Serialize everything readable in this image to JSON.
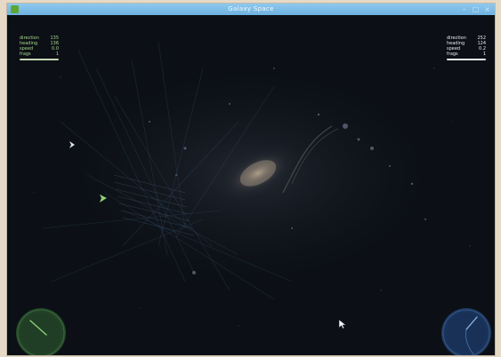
{
  "window": {
    "title": "Galaxy Space",
    "controls": [
      "–",
      "□",
      "×"
    ]
  },
  "hud_left": {
    "rows": [
      {
        "label": "direction",
        "value": "135"
      },
      {
        "label": "heading",
        "value": "136"
      },
      {
        "label": "speed",
        "value": "0.0"
      },
      {
        "label": "frags",
        "value": "1"
      }
    ],
    "bar_fill": 1.0
  },
  "hud_right": {
    "rows": [
      {
        "label": "direction",
        "value": "252"
      },
      {
        "label": "heading",
        "value": "124"
      },
      {
        "label": "speed",
        "value": "0.2"
      },
      {
        "label": "frags",
        "value": "1"
      }
    ],
    "bar_fill": 1.0
  },
  "joystick_left": {
    "color": "#316433",
    "icon": "thrust-joystick-icon"
  },
  "joystick_right": {
    "color": "#224680",
    "icon": "aim-joystick-icon"
  },
  "colors": {
    "space": "#0c1016",
    "titlebar": "#7dbde7",
    "hud_left": "#a9d88b",
    "hud_right": "#e9edf2"
  }
}
